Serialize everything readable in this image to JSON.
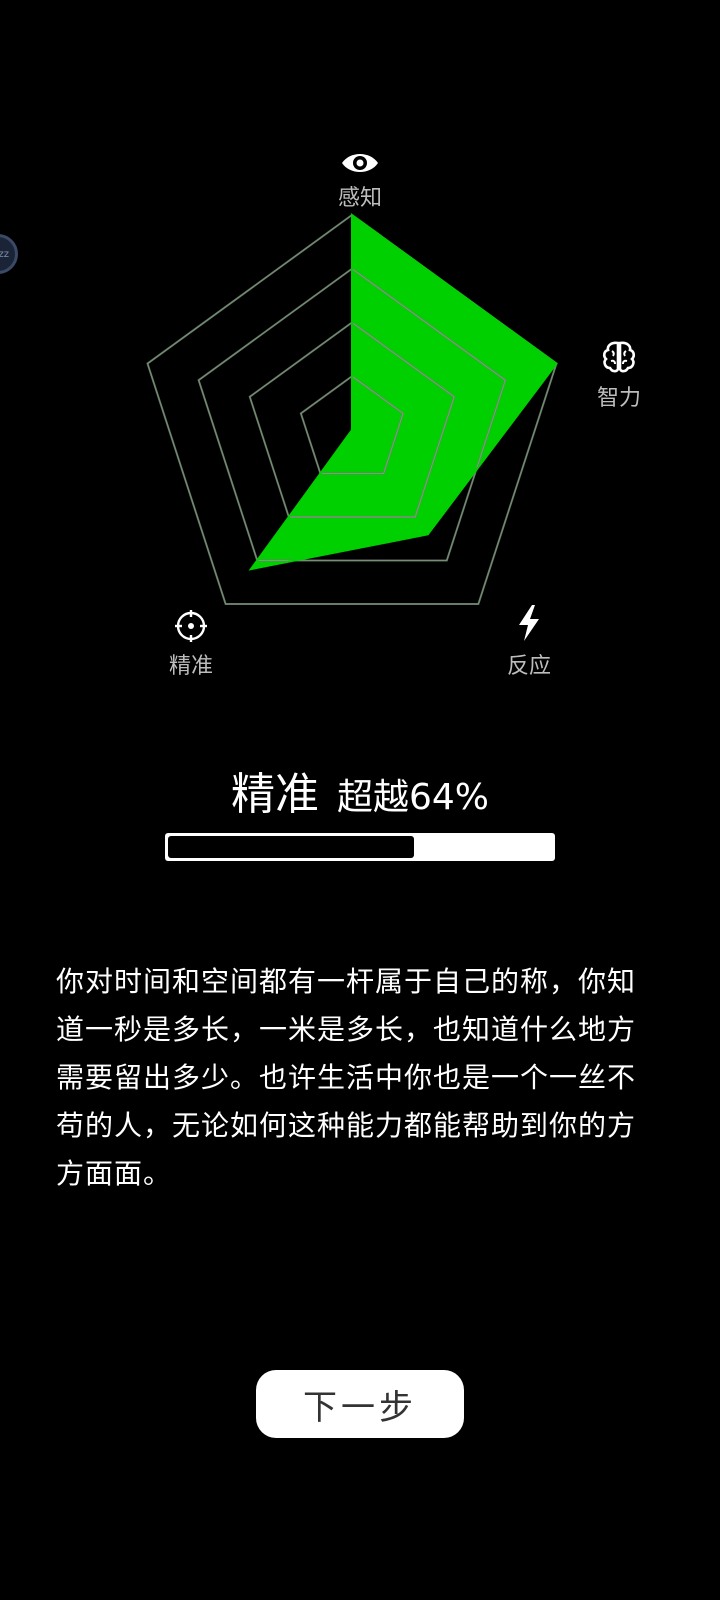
{
  "radar": {
    "axes": [
      {
        "label": "感知",
        "icon": "eye-icon",
        "value": 1.0
      },
      {
        "label": "智力",
        "icon": "brain-icon",
        "value": 1.0
      },
      {
        "label": "反应",
        "icon": "lightning-icon",
        "value": 0.6
      },
      {
        "label": "精准",
        "icon": "crosshair-icon",
        "value": 0.8
      },
      {
        "label": "",
        "icon": "",
        "value": 0.0
      }
    ],
    "fill_color": "#00d000",
    "grid_color": "#777777"
  },
  "result": {
    "name": "精准",
    "percent_text": "超越64%",
    "percent": 64
  },
  "description": "你对时间和空间都有一杆属于自己的称，你知道一秒是多长，一米是多长，也知道什么地方需要留出多少。也许生活中你也是一个一丝不苟的人，无论如何这种能力都能帮助到你的方方面面。",
  "next_button": "下一步",
  "floating_bubble": "zz"
}
